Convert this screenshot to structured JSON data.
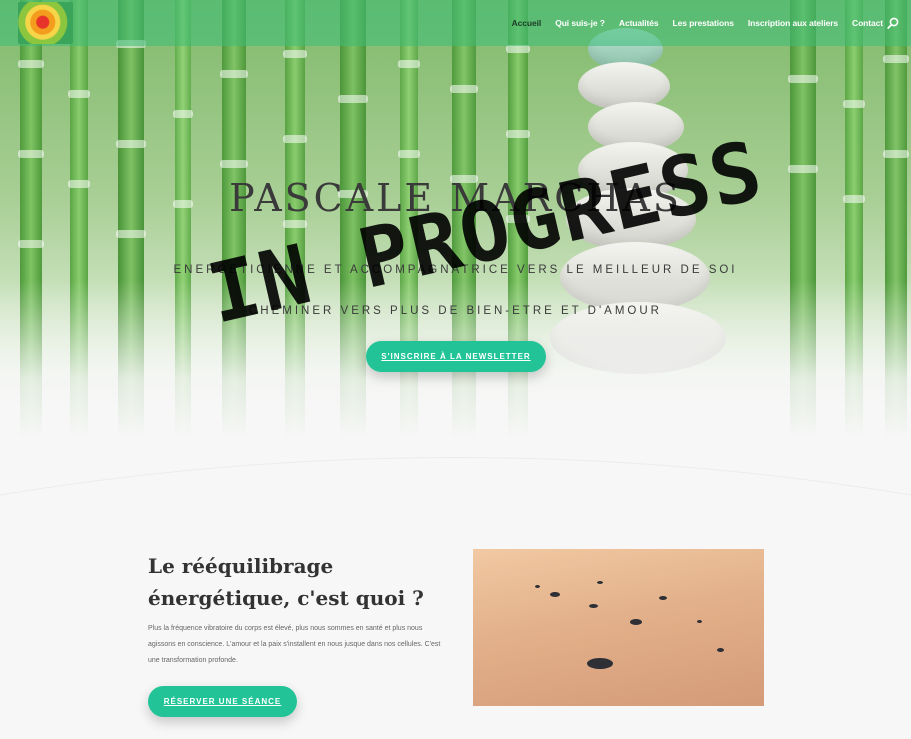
{
  "nav": {
    "items": [
      {
        "label": "Accueil",
        "active": true
      },
      {
        "label": "Qui suis-je ?",
        "active": false
      },
      {
        "label": "Actualités",
        "active": false
      },
      {
        "label": "Les prestations",
        "active": false
      },
      {
        "label": "Inscription aux ateliers",
        "active": false
      },
      {
        "label": "Contact",
        "active": false
      }
    ],
    "search_icon": "search-icon"
  },
  "hero": {
    "title": "PASCALE MARCHAS",
    "subtitle_1": "ENERGETICIENNE ET ACCOMPAGNATRICE VERS LE MEILLEUR DE SOI",
    "subtitle_2": "CHEMINER VERS PLUS DE BIEN-ETRE ET D'AMOUR",
    "newsletter_button": "S'inscrire à la newsletter",
    "stamp": "IN PROGRESS"
  },
  "section": {
    "title": "Le rééquilibrage énergétique, c'est quoi ?",
    "text": "Plus la fréquence vibratoire du corps est élevé, plus nous sommes en santé et plus nous agissons en conscience. L'amour et la paix s'installent en nous jusque dans nos cellules. C'est une transformation profonde.",
    "book_button": "Réserver une séance"
  },
  "colors": {
    "accent": "#22c497",
    "topbar": "#3cbe78",
    "heading": "#333333"
  }
}
